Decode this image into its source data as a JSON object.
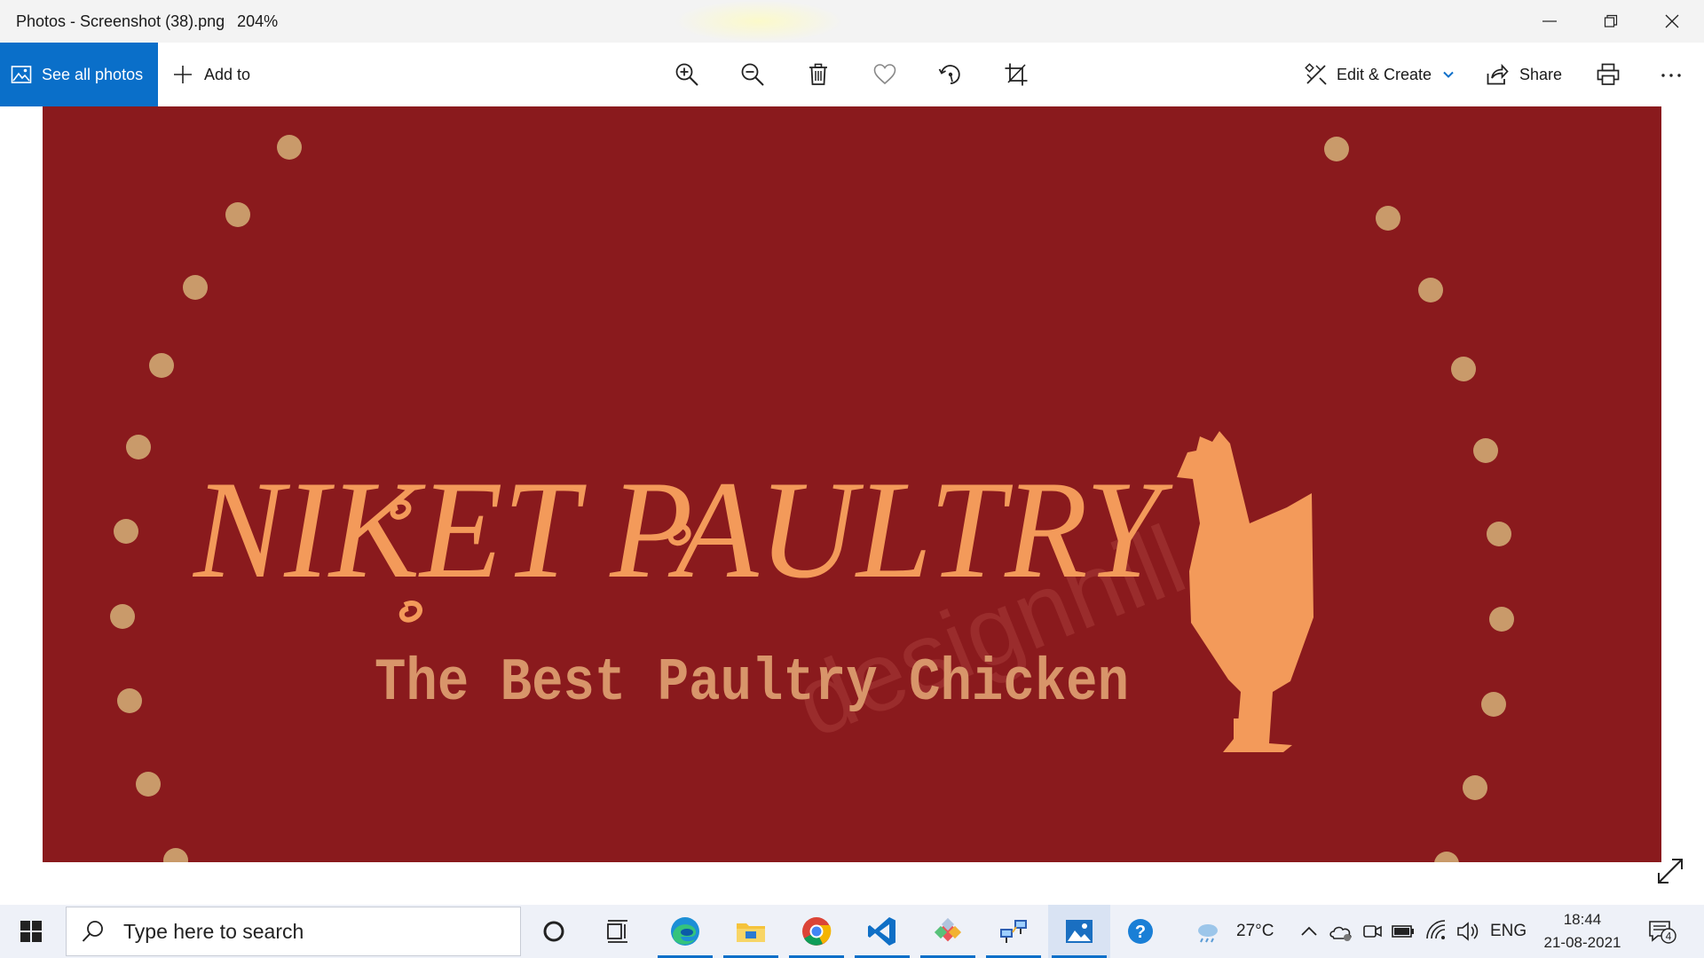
{
  "window": {
    "title": "Photos - Screenshot (38).png",
    "zoom": "204%"
  },
  "toolbar": {
    "see_all_photos": "See all photos",
    "add_to": "Add to",
    "edit_create": "Edit & Create",
    "share": "Share",
    "tools": [
      "zoom-in-icon",
      "zoom-out-icon",
      "delete-icon",
      "heart-icon",
      "rotate-icon",
      "crop-icon",
      "print-icon",
      "more-icon"
    ]
  },
  "photo": {
    "background_color": "#8a1a1d",
    "accent_color": "#f39a5a",
    "dot_color": "#c99a6a",
    "brand_name": "NIKET PAULTRY",
    "tagline": "The Best Paultry Chicken",
    "watermark": "designhill"
  },
  "taskbar": {
    "search_placeholder": "Type here to search",
    "weather": "27°C",
    "language": "ENG",
    "time": "18:44",
    "date": "21-08-2021",
    "notification_count": "4",
    "accent_color": "#0a6fc9"
  }
}
